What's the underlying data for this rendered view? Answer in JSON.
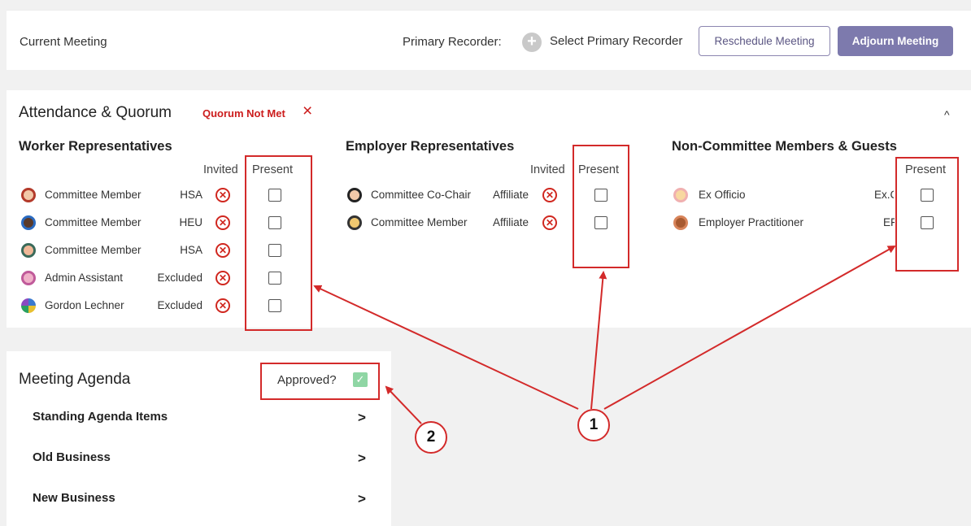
{
  "header": {
    "title": "Current Meeting",
    "recorder_label": "Primary Recorder:",
    "recorder_plus": "+",
    "recorder_select": "Select Primary Recorder",
    "reschedule_label": "Reschedule Meeting",
    "adjourn_label": "Adjourn Meeting"
  },
  "attendance": {
    "title": "Attendance & Quorum",
    "quorum_status": "Quorum Not Met",
    "quorum_icon": "×",
    "collapse_icon": "^",
    "worker": {
      "title": "Worker Representatives",
      "invited_header": "Invited",
      "present_header": "Present",
      "rows": [
        {
          "name": "Committee Member",
          "tag": "HSA"
        },
        {
          "name": "Committee Member",
          "tag": "HEU"
        },
        {
          "name": "Committee Member",
          "tag": "HSA"
        },
        {
          "name": "Admin Assistant",
          "tag": "Excluded"
        },
        {
          "name": "Gordon Lechner",
          "tag": "Excluded"
        }
      ]
    },
    "employer": {
      "title": "Employer Representatives",
      "invited_header": "Invited",
      "present_header": "Present",
      "rows": [
        {
          "name": "Committee Co-Chair",
          "tag": "Affiliate"
        },
        {
          "name": "Committee Member",
          "tag": "Affiliate"
        }
      ]
    },
    "guests": {
      "title": "Non-Committee Members & Guests",
      "present_header": "Present",
      "rows": [
        {
          "name": "Ex Officio",
          "tag": "Ex.C"
        },
        {
          "name": "Employer Practitioner",
          "tag": "EF"
        }
      ]
    },
    "invited_icon": "✕"
  },
  "agenda": {
    "title": "Meeting Agenda",
    "approved_label": "Approved?",
    "approved_check": "✓",
    "chevron": ">",
    "items": [
      {
        "label": "Standing Agenda Items"
      },
      {
        "label": "Old Business"
      },
      {
        "label": "New Business"
      }
    ]
  },
  "annotations": {
    "callout_1": "1",
    "callout_2": "2"
  },
  "colors": {
    "accent": "#7d7aad",
    "annotation_red": "#d32a2a",
    "status_red": "#cc1d1d",
    "approved_green": "#8fd6a4"
  }
}
